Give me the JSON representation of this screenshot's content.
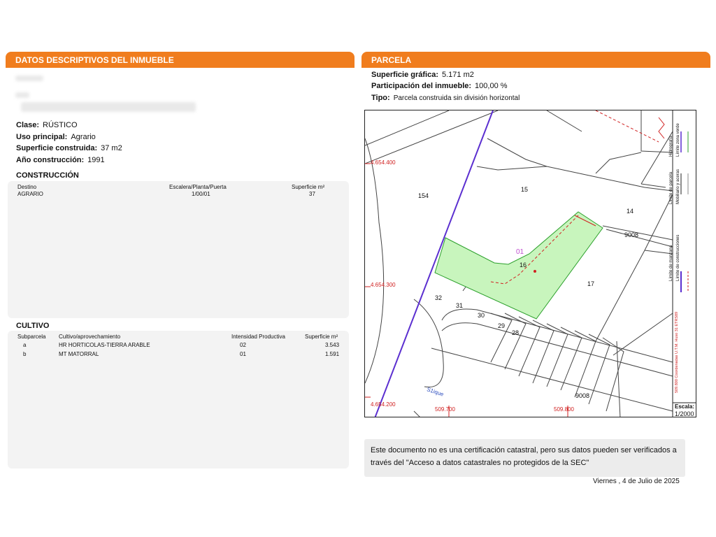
{
  "left": {
    "header": "DATOS DESCRIPTIVOS DEL INMUEBLE",
    "fields": [
      {
        "label": "Clase:",
        "value": "RÚSTICO"
      },
      {
        "label": "Uso principal:",
        "value": "Agrario"
      },
      {
        "label": "Superficie construida:",
        "value": "37 m2"
      },
      {
        "label": "Año construcción:",
        "value": "1991"
      }
    ],
    "construccion": {
      "title": "CONSTRUCCIÓN",
      "headers": [
        "Destino",
        "Escalera/Planta/Puerta",
        "Superficie m²"
      ],
      "rows": [
        [
          "AGRARIO",
          "1/00/01",
          "37"
        ]
      ]
    },
    "cultivo": {
      "title": "CULTIVO",
      "headers": [
        "Subparcela",
        "Cultivo/aprovechamiento",
        "Intensidad Productiva",
        "Superficie m²"
      ],
      "rows": [
        [
          "a",
          "HR HORTICOLAS-TIERRA ARABLE",
          "02",
          "3.543"
        ],
        [
          "b",
          "MT MATORRAL",
          "01",
          "1.591"
        ]
      ]
    }
  },
  "right": {
    "header": "PARCELA",
    "fields": [
      {
        "label": "Superficie gráfica:",
        "value": "5.171 m2"
      },
      {
        "label": "Participación del inmueble:",
        "value": "100,00 %"
      },
      {
        "label": "Tipo:",
        "value": "Parcela construida sin división horizontal"
      }
    ],
    "map": {
      "coords": {
        "y1": "4.654.400",
        "y2": "4.654.300",
        "y3": "4.654.200",
        "x1": "509.700",
        "x2": "509.800"
      },
      "parcels": [
        "154",
        "15",
        "14",
        "9008",
        "16",
        "17",
        "32",
        "31",
        "30",
        "29",
        "28",
        "9008"
      ],
      "highlight_label": "01",
      "road_label": "S1ique",
      "legend": [
        "Hidrografía",
        "Límite de parcela",
        "Límite zona verde",
        "Mobiliario y aceras",
        "Límite de manzana",
        "Límite de construcciones"
      ],
      "legend_coords": "509.800 Coordenadas U.T.M. Huso 31 ETRS89",
      "scale_label": "Escala:",
      "scale_value": "1/2000",
      "colors": {
        "parcel_fill": "#c8f5bd",
        "parcel_line": "#2ca02c",
        "boundary": "#5b2fd0",
        "coord": "#d02020"
      }
    },
    "note": "Este documento no es una certificación catastral, pero sus datos pueden ser verificados a través del \"Acceso a datos catastrales no protegidos de la SEC\"",
    "date": "Viernes , 4 de Julio de 2025"
  }
}
